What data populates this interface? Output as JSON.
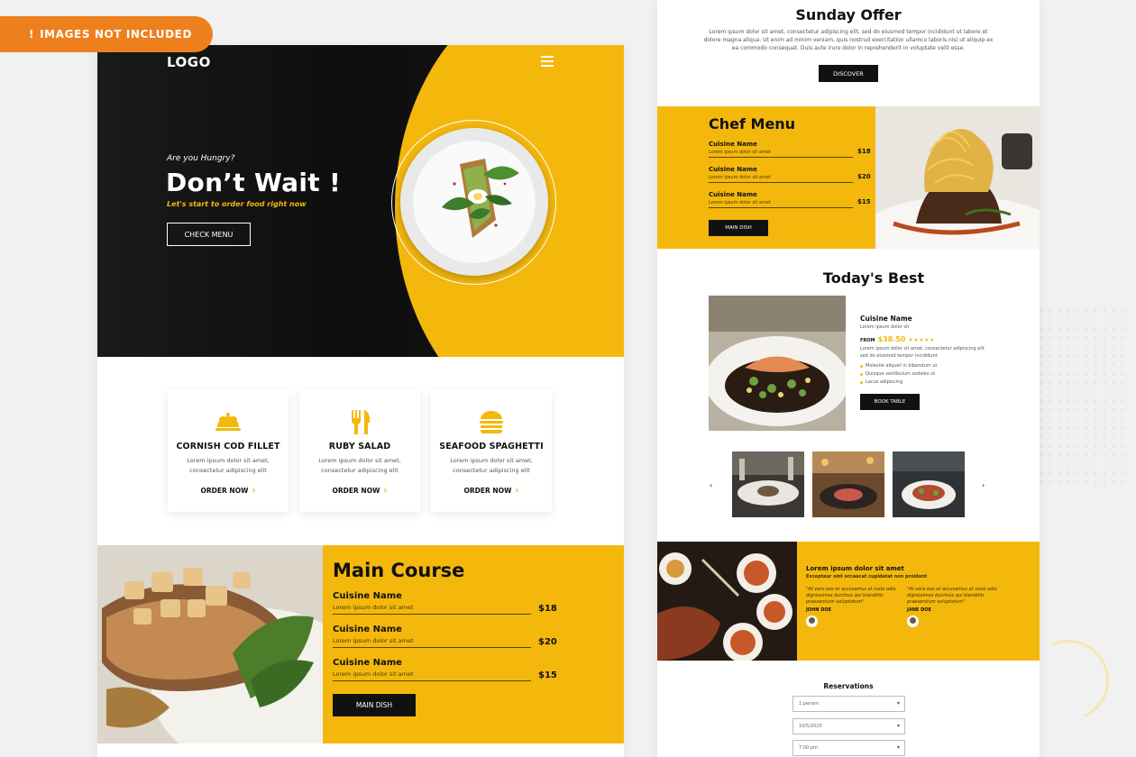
{
  "badge": {
    "text": "IMAGES NOT INCLUDED"
  },
  "hero": {
    "logo": "LOGO",
    "eyebrow": "Are you Hungry?",
    "headline": "Don’t Wait !",
    "tagline": "Let's start to order food right now",
    "cta": "CHECK MENU"
  },
  "cards": [
    {
      "title": "CORNISH COD FILLET",
      "desc": "Lorem ipsum dolor sit amet, consectetur adipiscing elit",
      "order": "ORDER NOW",
      "icon": "chef-cloche-icon"
    },
    {
      "title": "RUBY SALAD",
      "desc": "Lorem ipsum dolor sit amet, consectetur adipiscing elit",
      "order": "ORDER NOW",
      "icon": "fork-knife-icon"
    },
    {
      "title": "SEAFOOD SPAGHETTI",
      "desc": "Lorem ipsum dolor sit amet, consectetur adipiscing elit",
      "order": "ORDER NOW",
      "icon": "burger-icon"
    }
  ],
  "main_course": {
    "title": "Main Course",
    "items": [
      {
        "name": "Cuisine Name",
        "desc": "Lorem ipsum dolor sit amet",
        "price": "$18"
      },
      {
        "name": "Cuisine Name",
        "desc": "Lorem ipsum dolor sit amet",
        "price": "$20"
      },
      {
        "name": "Cuisine Name",
        "desc": "Lorem ipsum dolor sit amet",
        "price": "$15"
      }
    ],
    "button": "MAIN DISH"
  },
  "sunday_offer": {
    "title": "Sunday Offer",
    "text": "Lorem ipsum dolor sit amet, consectetur adipiscing elit, sed do eiusmod tempor incididunt ut labore et dolore magna aliqua. Ut enim ad minim veniam, quis nostrud exercitation ullamco laboris nisi ut aliquip ex ea commodo consequat. Duis aute irure dolor in reprehenderit in voluptate velit esse.",
    "button": "DISCOVER"
  },
  "chef_menu": {
    "title": "Chef Menu",
    "items": [
      {
        "name": "Cuisine Name",
        "desc": "Lorem ipsum dolor sit amet",
        "price": "$18"
      },
      {
        "name": "Cuisine Name",
        "desc": "Lorem ipsum dolor sit amet",
        "price": "$20"
      },
      {
        "name": "Cuisine Name",
        "desc": "Lorem ipsum dolor sit amet",
        "price": "$15"
      }
    ],
    "button": "MAIN DISH"
  },
  "todays_best": {
    "title": "Today's Best",
    "name": "Cuisine Name",
    "subtitle": "Lorem ipsum dolor sit",
    "from": "FROM",
    "price": "$38.50",
    "stars": "★★★★★",
    "desc": "Lorem ipsum dolor sit amet, consectetur adipiscing elit sed do eiusmod tempor incididunt",
    "bullets": [
      "Molestie aliquet in bibendum ut",
      "Quisque vestibulum sodales ut",
      "Lacus adipiscing"
    ],
    "button": "BOOK TABLE",
    "prev": "‹",
    "next": "›"
  },
  "testimonials": {
    "heading": "Lorem ipsum dolor sit amet",
    "subheading": "Excepteur sint occaecat cupidatat non proident",
    "items": [
      {
        "quote": "\"At vero eos et accusamus et iusto odio dignissimos ducimus qui blanditiis praesentium voluptatum\"",
        "author": "JOHN DOE"
      },
      {
        "quote": "\"At vero eos et accusamus et iusto odio dignissimos ducimus qui blanditiis praesentium voluptatum\"",
        "author": "JANE DOE"
      }
    ]
  },
  "reservations": {
    "title": "Reservations",
    "fields": [
      "1 person",
      "10/5/2020",
      "7:00 pm"
    ]
  },
  "colors": {
    "accent": "#f4b80d",
    "dark": "#111111",
    "badge": "#ee7f1d"
  }
}
